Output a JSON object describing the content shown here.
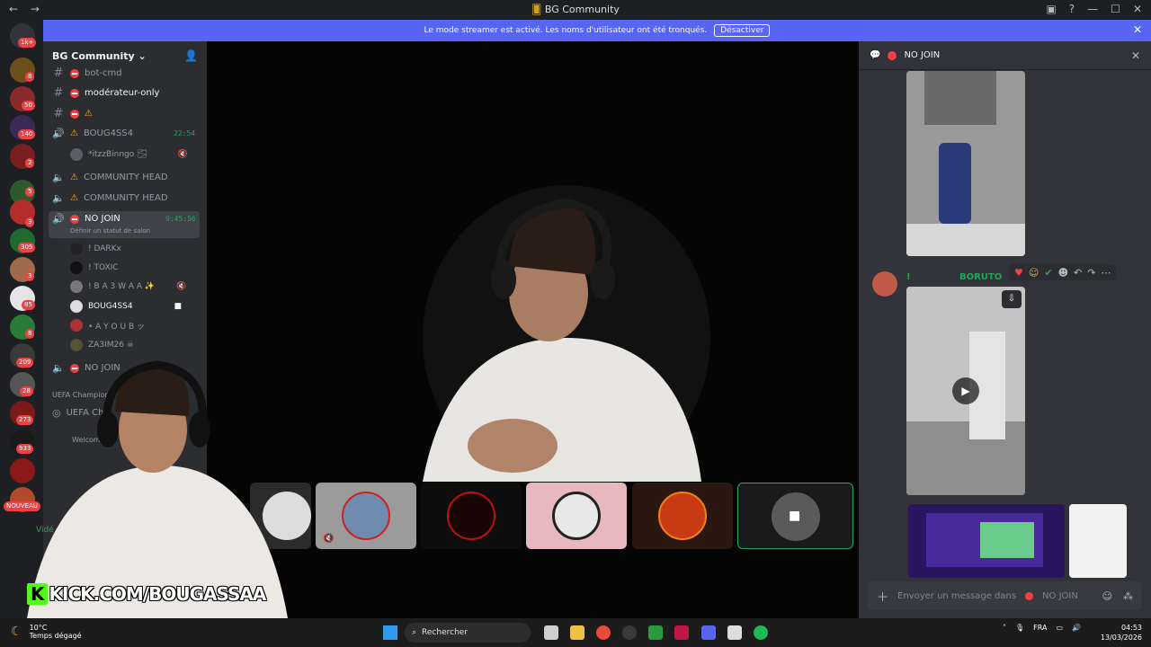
{
  "window": {
    "title": "BG Community",
    "back": "←",
    "forward": "→"
  },
  "banner": {
    "text": "Le mode streamer est activé. Les noms d'utilisateur ont été tronqués.",
    "button": "Désactiver"
  },
  "servers": {
    "top_badge": "1k+",
    "badges": [
      "8",
      "50",
      "140",
      "2",
      "5",
      "3",
      "305",
      "3",
      "85",
      "8",
      "209",
      "28",
      "273",
      "933",
      "NOUVEAU"
    ]
  },
  "guild": {
    "name": "BG Community"
  },
  "channels": {
    "bot_cmd": "bot-cmd",
    "moderator": "modérateur-only",
    "voice1": {
      "name": "BOUG4SS4",
      "time": "22:54",
      "user": "*itzzBinngo 🌫"
    },
    "community1": "COMMUNITY HEAD",
    "community2": "COMMUNITY HEAD",
    "nojoin": {
      "name": "NO JOIN",
      "time": "9:45:56",
      "status": "Définir un statut de salon"
    },
    "users": [
      "! DARKx",
      "! TOXIC",
      "! B A 3 W A A ✨",
      "BOUG4SS4",
      "• A Y O U B ッ",
      "ZA3IM26 ☠"
    ],
    "nojoin2": "NO JOIN",
    "uefa_cat": "UEFA Champions",
    "uefa_ch": "UEFA Cha",
    "welcome": "Welcome To",
    "video_label": "Vidé"
  },
  "chat": {
    "header": "NO JOIN",
    "exclaim": "!",
    "author": "BORUTO",
    "input_placeholder": "Envoyer un message dans",
    "input_channel": "NO JOIN"
  },
  "stream_overlay": {
    "kick_k": "K",
    "kick_text": "KICK.COM/BOUGASSAA"
  },
  "taskbar": {
    "temp": "10°C",
    "weather": "Temps dégagé",
    "search": "Rechercher",
    "lang": "FRA",
    "time": "04:53",
    "date": "13/03/2026"
  }
}
